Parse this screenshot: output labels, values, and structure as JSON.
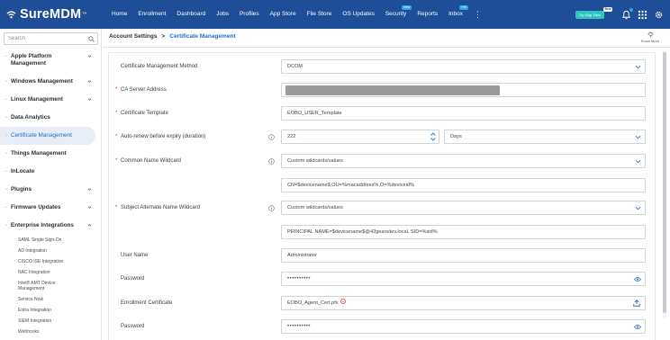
{
  "brand": {
    "name": "SureMDM",
    "tm": "™"
  },
  "topnav": {
    "items": [
      {
        "label": "Home"
      },
      {
        "label": "Enrollment"
      },
      {
        "label": "Dashboard"
      },
      {
        "label": "Jobs"
      },
      {
        "label": "Profiles"
      },
      {
        "label": "App Store"
      },
      {
        "label": "File Store"
      },
      {
        "label": "OS Updates"
      },
      {
        "label": "Security",
        "badge": "New"
      },
      {
        "label": "Reports"
      },
      {
        "label": "Inbox",
        "badge": "+99"
      }
    ],
    "try_button": "Try Map View",
    "try_badge": "Beta"
  },
  "sidebar": {
    "search_placeholder": "Search",
    "items": [
      {
        "label": "Apple Platform Management"
      },
      {
        "label": "Windows Management"
      },
      {
        "label": "Linux Management"
      },
      {
        "label": "Data Analytics"
      },
      {
        "label": "Certificate Management"
      },
      {
        "label": "Things Management"
      },
      {
        "label": "InLocate"
      },
      {
        "label": "Plugins"
      },
      {
        "label": "Firmware Updates"
      },
      {
        "label": "Enterprise Integrations"
      }
    ],
    "sub_items": [
      {
        "label": "SAML Single Sign-On"
      },
      {
        "label": "AD Integration"
      },
      {
        "label": "CISCO ISE Integration"
      },
      {
        "label": "NAC Integration"
      },
      {
        "label": "Intel® AMT Device Management"
      },
      {
        "label": "Service Now"
      },
      {
        "label": "Entra Integration"
      },
      {
        "label": "SIEM Integration"
      },
      {
        "label": "Webhooks"
      }
    ]
  },
  "breadcrumb": {
    "parent": "Account Settings",
    "separator": ">",
    "current": "Certificate Management"
  },
  "know_more": "Know More",
  "form": {
    "method": {
      "label": "Certificate Management Method",
      "value": "DCOM"
    },
    "ca_server": {
      "label": "CA Server Address"
    },
    "template": {
      "label": "Certificate Template",
      "value": "EOBO_USER_Template"
    },
    "auto_renew": {
      "label": "Auto-renew before expiry (duration)",
      "value": "222",
      "unit": "Days"
    },
    "cn_wildcard": {
      "label": "Common Name Wildcard",
      "value": "Custom wildcards/values",
      "custom": "CN=$devicename$,OU=%macaddress%,O=%deviceid%"
    },
    "san_wildcard": {
      "label": "Subject Alternate Name Wildcard",
      "value": "Custom wildcards/values",
      "custom": "PRINCIPAL NAME=$devicename$@42gearsdev.local, SID=%sid%"
    },
    "username": {
      "label": "User Name",
      "value": "Administrator"
    },
    "password": {
      "label": "Password",
      "value": "••••••••••"
    },
    "enrollment_cert": {
      "label": "Enrollment Certificate",
      "value": "EOBO_Agent_Cert.pfx"
    },
    "password2": {
      "label": "Password",
      "value": "••••••••••"
    }
  },
  "colors": {
    "header": "#1f4e99",
    "accent": "#1f6ec6",
    "required": "#d9302b",
    "active_bg": "#e6edf6"
  }
}
